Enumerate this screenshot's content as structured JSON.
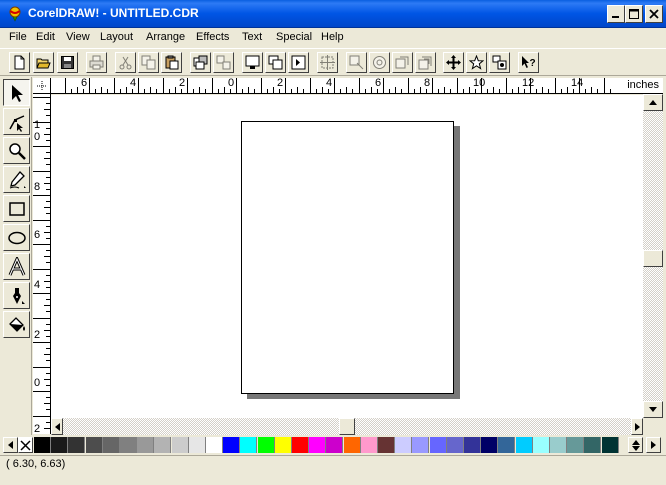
{
  "window": {
    "title": "CorelDRAW! - UNTITLED.CDR"
  },
  "menu": [
    "File",
    "Edit",
    "View",
    "Layout",
    "Arrange",
    "Effects",
    "Text",
    "Special",
    "Help"
  ],
  "ruler": {
    "units": "inches",
    "horizontal_labels": [
      "6",
      "4",
      "2",
      "0",
      "2",
      "4",
      "6",
      "8",
      "10",
      "12",
      "14"
    ],
    "vertical_labels": [
      "1",
      "0",
      "8",
      "6",
      "4",
      "2",
      "0",
      "2"
    ]
  },
  "toolbar": {
    "buttons": [
      "new-icon",
      "open-icon",
      "save-icon",
      "print-icon",
      "cut-icon",
      "copy-icon",
      "paste-icon",
      "group-icon",
      "ungroup-icon",
      "wireframe-icon",
      "full-color-icon",
      "page-view-icon",
      "align-icon",
      "to-front-icon",
      "to-back-icon",
      "weld-icon",
      "trim-icon",
      "transform-icon",
      "symbols-icon",
      "node-edit-icon",
      "help-pointer-icon"
    ]
  },
  "toolbox": [
    "pick-tool",
    "shape-tool",
    "zoom-tool",
    "pencil-tool",
    "rectangle-tool",
    "ellipse-tool",
    "text-tool",
    "outline-tool",
    "fill-tool"
  ],
  "palette": {
    "colors": [
      "#000000",
      "#1a1a1a",
      "#333333",
      "#4d4d4d",
      "#666666",
      "#808080",
      "#999999",
      "#b3b3b3",
      "#cccccc",
      "#e6e6e6",
      "#ffffff",
      "#0000ff",
      "#00ffff",
      "#00ff00",
      "#ffff00",
      "#ff0000",
      "#ff00ff",
      "#cc00cc",
      "#ff6600",
      "#ff99cc",
      "#663333",
      "#ccccff",
      "#9999ff",
      "#6666ff",
      "#6666cc",
      "#333399",
      "#000066",
      "#336699",
      "#00ccff",
      "#99ffff",
      "#99cccc",
      "#669999",
      "#336666",
      "#003333"
    ]
  },
  "status": {
    "coordinates": "( 6.30,  6.63)"
  }
}
